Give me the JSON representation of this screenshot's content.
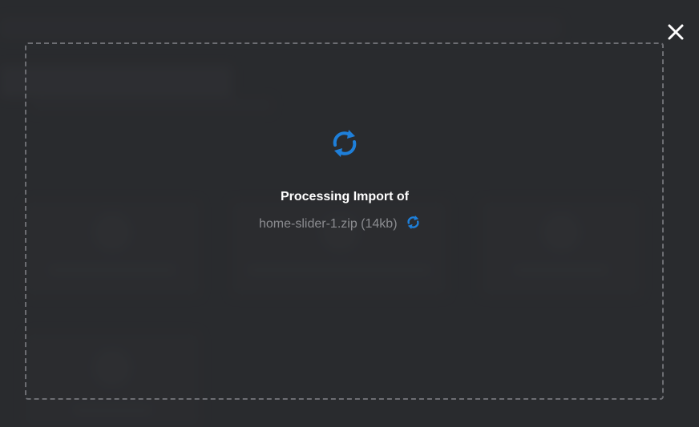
{
  "dialog": {
    "close_icon": "close-icon",
    "status_icon": "sync-icon",
    "title": "Processing Import of",
    "file_name": "home-slider-1.zip",
    "file_size": "(14kb)",
    "inline_icon": "sync-icon"
  },
  "colors": {
    "accent": "#1e7fd9",
    "title_text": "#ffffff",
    "file_text": "#8b8c90",
    "dashed_border": "#6d6e73",
    "background": "#2e2f33"
  }
}
